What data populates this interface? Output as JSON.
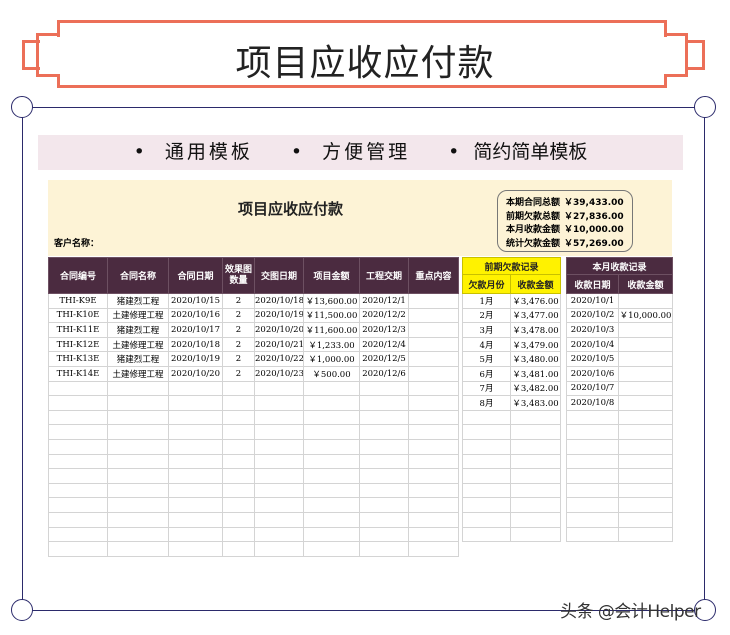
{
  "banner_title": "项目应收应付款",
  "tags": [
    "• 通用模板",
    "• 方便管理",
    "• 简约简单模板"
  ],
  "sheet": {
    "title": "项目应收应付款",
    "customer_label": "客户名称：",
    "summary": [
      {
        "label": "本期合同总额",
        "value": "￥39,433.00"
      },
      {
        "label": "前期欠款总额",
        "value": "￥27,836.00"
      },
      {
        "label": "本月收款金额",
        "value": "￥10,000.00"
      },
      {
        "label": "统计欠款金额",
        "value": "￥57,269.00"
      }
    ],
    "main_headers": [
      "合同编号",
      "合同名称",
      "合同日期",
      "效果图数量",
      "交图日期",
      "项目金额",
      "工程交期",
      "重点内容"
    ],
    "main_rows": [
      [
        "THI-K9E",
        "猪建烈工程",
        "2020/10/15",
        "2",
        "2020/10/18",
        "￥13,600.00",
        "2020/12/1",
        ""
      ],
      [
        "THI-K10E",
        "土建修理工程",
        "2020/10/16",
        "2",
        "2020/10/19",
        "￥11,500.00",
        "2020/12/2",
        ""
      ],
      [
        "THI-K11E",
        "猪建烈工程",
        "2020/10/17",
        "2",
        "2020/10/20",
        "￥11,600.00",
        "2020/12/3",
        ""
      ],
      [
        "THI-K12E",
        "土建修理工程",
        "2020/10/18",
        "2",
        "2020/10/21",
        "￥1,233.00",
        "2020/12/4",
        ""
      ],
      [
        "THI-K13E",
        "猪建烈工程",
        "2020/10/19",
        "2",
        "2020/10/22",
        "￥1,000.00",
        "2020/12/5",
        ""
      ],
      [
        "THI-K14E",
        "土建修理工程",
        "2020/10/20",
        "2",
        "2020/10/23",
        "￥500.00",
        "2020/12/6",
        ""
      ]
    ],
    "prior": {
      "title": "前期欠款记录",
      "headers": [
        "欠款月份",
        "收款金额"
      ],
      "rows": [
        [
          "1月",
          "￥3,476.00"
        ],
        [
          "2月",
          "￥3,477.00"
        ],
        [
          "3月",
          "￥3,478.00"
        ],
        [
          "4月",
          "￥3,479.00"
        ],
        [
          "5月",
          "￥3,480.00"
        ],
        [
          "6月",
          "￥3,481.00"
        ],
        [
          "7月",
          "￥3,482.00"
        ],
        [
          "8月",
          "￥3,483.00"
        ]
      ]
    },
    "month": {
      "title": "本月收款记录",
      "headers": [
        "收款日期",
        "收款金额"
      ],
      "rows": [
        [
          "2020/10/1",
          ""
        ],
        [
          "2020/10/2",
          "￥10,000.00"
        ],
        [
          "2020/10/3",
          ""
        ],
        [
          "2020/10/4",
          ""
        ],
        [
          "2020/10/5",
          ""
        ],
        [
          "2020/10/6",
          ""
        ],
        [
          "2020/10/7",
          ""
        ],
        [
          "2020/10/8",
          ""
        ]
      ]
    }
  },
  "watermark": "头条 @会计Helper",
  "colors": {
    "banner": "#ec6f58",
    "header": "#4b2b40",
    "yellow": "#fff200",
    "cream": "#fdf3d6",
    "frame": "#2b2a6b"
  }
}
